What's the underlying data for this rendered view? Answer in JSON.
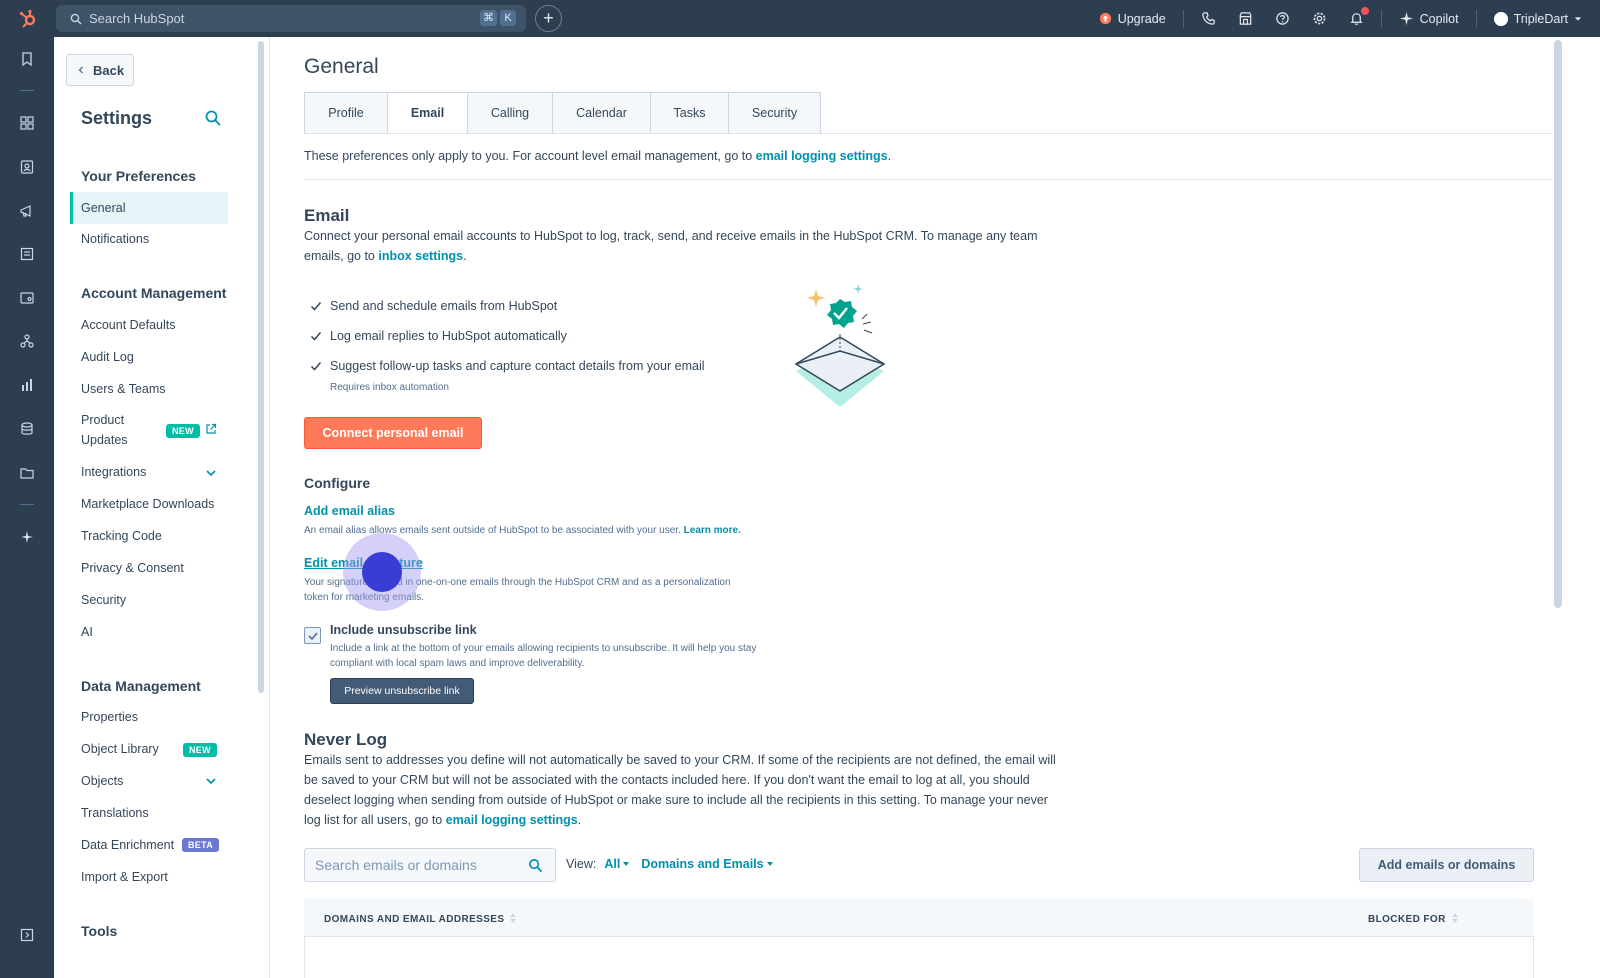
{
  "topnav": {
    "search_placeholder": "Search HubSpot",
    "kbd": [
      "⌘",
      "K"
    ],
    "upgrade": "Upgrade",
    "copilot": "Copilot",
    "account": "TripleDart"
  },
  "sidebar": {
    "back": "Back",
    "title": "Settings",
    "sections": {
      "prefs": "Your Preferences",
      "account": "Account Management",
      "data": "Data Management",
      "tools": "Tools"
    },
    "prefs_items": [
      "General",
      "Notifications"
    ],
    "account_items": [
      "Account Defaults",
      "Audit Log",
      "Users & Teams",
      "Product",
      "Updates",
      "Integrations",
      "Marketplace Downloads",
      "Tracking Code",
      "Privacy & Consent",
      "Security",
      "AI"
    ],
    "data_items": [
      "Properties",
      "Object Library",
      "Objects",
      "Translations",
      "Data Enrichment",
      "Import & Export"
    ],
    "badge_new": "NEW",
    "badge_beta": "BETA"
  },
  "main": {
    "title": "General",
    "tabs": [
      "Profile",
      "Email",
      "Calling",
      "Calendar",
      "Tasks",
      "Security"
    ],
    "pref_note": "These preferences only apply to you. For account level email management, go to ",
    "pref_note_link": "email logging settings",
    "pref_note_end": ".",
    "email_h": "Email",
    "email_p1": "Connect your personal email accounts to HubSpot to log, track, send, and receive emails in the HubSpot CRM. To manage any team",
    "email_p2": "emails, go to ",
    "email_p2_link": "inbox settings",
    "email_p2_end": ".",
    "features": [
      "Send and schedule emails from HubSpot",
      "Log email replies to HubSpot automatically",
      "Suggest follow-up tasks and capture contact details from your email"
    ],
    "requires": "Requires inbox automation",
    "connect_btn": "Connect personal email",
    "configure_h": "Configure",
    "alias_link": "Add email alias",
    "alias_desc": "An email alias allows emails sent outside of HubSpot to be associated with your user. ",
    "alias_learn": "Learn more.",
    "sig_link": "Edit email signature",
    "sig_desc1": "Your signature is used in one-on-one emails through the HubSpot CRM and as a personalization",
    "sig_desc2": "token for marketing emails.",
    "unsub_label": "Include unsubscribe link",
    "unsub_desc1": "Include a link at the bottom of your emails allowing recipients to unsubscribe. It will help you stay",
    "unsub_desc2": "compliant with local spam laws and improve deliverability.",
    "preview_btn": "Preview unsubscribe link",
    "never_h": "Never Log",
    "never_p1": "Emails sent to addresses you define will not automatically be saved to your CRM. If some of the recipients are not defined, the email will",
    "never_p2": "be saved to your CRM but will not be associated with the contacts included here. If you don't want the email to log at all, you should",
    "never_p3": "deselect logging when sending from outside of HubSpot or make sure to include all the recipients in this setting. To manage your never",
    "never_p4": "log list for all users, go to ",
    "never_p4_link": "email logging settings",
    "never_p4_end": ".",
    "search_placeholder": "Search emails or domains",
    "view_label": "View:",
    "view_all": "All",
    "view_type": "Domains and Emails",
    "add_btn": "Add emails or domains",
    "col1": "DOMAINS AND EMAIL ADDRESSES",
    "col2": "BLOCKED FOR"
  },
  "colors": {
    "nav_bg": "#2d3e50",
    "accent_orange": "#ff7a59",
    "link_teal": "#0091ae",
    "badge_teal": "#00bda5",
    "badge_beta": "#6a78d1"
  }
}
